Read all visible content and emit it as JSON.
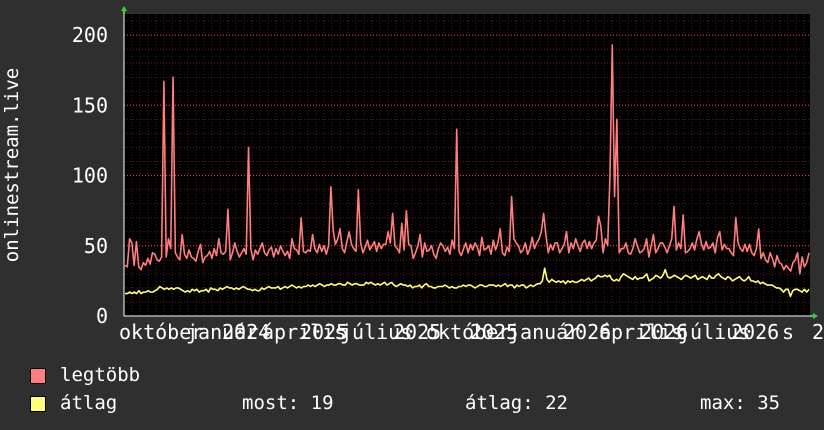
{
  "chart_data": {
    "type": "line",
    "ylabel": "onlinestream.live",
    "ylim": [
      0,
      215
    ],
    "yticks": [
      "0",
      "50",
      "100",
      "150",
      "200"
    ],
    "xticks": [
      "október",
      "január",
      "2024",
      "április",
      "2025",
      "július",
      "2025",
      "október",
      "2025",
      "január",
      "2026",
      "április",
      "2026",
      "július",
      "2026",
      "s",
      "2"
    ],
    "colors": {
      "max": "#ff7e7e",
      "avg": "#ffff7e",
      "grid": "#ff4040",
      "axis": "#ffffff"
    },
    "series": [
      {
        "name": "legtöbb",
        "values": [
          36,
          35,
          55,
          52,
          36,
          53,
          35,
          33,
          38,
          36,
          41,
          37,
          45,
          44,
          40,
          39,
          42,
          167,
          42,
          55,
          48,
          170,
          45,
          42,
          40,
          58,
          44,
          41,
          47,
          42,
          41,
          39,
          46,
          51,
          38,
          42,
          43,
          46,
          41,
          48,
          43,
          55,
          45,
          44,
          46,
          76,
          40,
          45,
          52,
          46,
          42,
          45,
          48,
          44,
          120,
          48,
          40,
          47,
          44,
          48,
          52,
          45,
          43,
          47,
          49,
          42,
          48,
          44,
          50,
          46,
          43,
          46,
          41,
          55,
          48,
          47,
          44,
          70,
          46,
          45,
          47,
          46,
          58,
          48,
          45,
          51,
          46,
          50,
          44,
          50,
          92,
          61,
          51,
          55,
          62,
          48,
          45,
          53,
          60,
          51,
          48,
          46,
          90,
          52,
          45,
          49,
          54,
          47,
          50,
          53,
          46,
          52,
          48,
          51,
          51,
          60,
          52,
          73,
          50,
          48,
          45,
          66,
          47,
          75,
          51,
          50,
          41,
          45,
          50,
          58,
          42,
          52,
          46,
          47,
          50,
          44,
          41,
          48,
          52,
          50,
          46,
          49,
          44,
          54,
          48,
          133,
          46,
          43,
          48,
          52,
          45,
          51,
          47,
          52,
          49,
          43,
          56,
          47,
          48,
          50,
          44,
          54,
          47,
          52,
          62,
          45,
          43,
          49,
          46,
          85,
          55,
          52,
          50,
          45,
          47,
          52,
          44,
          48,
          56,
          48,
          52,
          55,
          60,
          73,
          58,
          45,
          51,
          47,
          52,
          52,
          45,
          48,
          51,
          60,
          45,
          52,
          48,
          55,
          50,
          46,
          52,
          54,
          48,
          53,
          48,
          52,
          54,
          71,
          64,
          45,
          55,
          50,
          100,
          193,
          85,
          140,
          45,
          48,
          48,
          52,
          45,
          44,
          48,
          55,
          50,
          45,
          46,
          48,
          55,
          42,
          50,
          58,
          45,
          48,
          52,
          52,
          49,
          45,
          50,
          55,
          78,
          47,
          52,
          48,
          72,
          45,
          46,
          48,
          52,
          47,
          55,
          60,
          51,
          47,
          53,
          48,
          49,
          52,
          45,
          56,
          60,
          47,
          51,
          48,
          48,
          45,
          43,
          70,
          52,
          48,
          46,
          51,
          46,
          51,
          45,
          43,
          48,
          62,
          41,
          45,
          40,
          38,
          45,
          41,
          35,
          43,
          38,
          37,
          33,
          36,
          34,
          32,
          38,
          40,
          45,
          30,
          42,
          35,
          38,
          45
        ]
      },
      {
        "name": "átlag",
        "values": [
          16,
          16,
          17,
          16,
          17,
          16,
          18,
          16,
          17,
          17,
          18,
          17,
          17,
          18,
          19,
          21,
          20,
          19,
          20,
          19,
          20,
          19,
          20,
          20,
          19,
          18,
          17,
          18,
          17,
          19,
          18,
          19,
          17,
          18,
          18,
          19,
          17,
          20,
          19,
          19,
          18,
          20,
          19,
          20,
          21,
          20,
          20,
          19,
          20,
          19,
          20,
          21,
          20,
          19,
          19,
          18,
          19,
          18,
          18,
          20,
          19,
          20,
          21,
          20,
          20,
          20,
          21,
          19,
          20,
          21,
          20,
          21,
          22,
          21,
          20,
          21,
          20,
          21,
          21,
          22,
          21,
          22,
          21,
          22,
          23,
          22,
          21,
          22,
          22,
          23,
          22,
          22,
          23,
          23,
          22,
          22,
          24,
          23,
          22,
          23,
          23,
          22,
          22,
          22,
          24,
          23,
          24,
          23,
          22,
          23,
          22,
          23,
          24,
          22,
          23,
          24,
          22,
          21,
          22,
          23,
          22,
          22,
          21,
          22,
          20,
          21,
          21,
          22,
          20,
          22,
          23,
          21,
          21,
          20,
          20,
          21,
          21,
          21,
          22,
          21,
          20,
          21,
          20,
          20,
          21,
          21,
          22,
          21,
          22,
          22,
          21,
          20,
          21,
          22,
          22,
          21,
          21,
          22,
          22,
          22,
          21,
          22,
          21,
          22,
          23,
          21,
          22,
          22,
          20,
          22,
          21,
          22,
          22,
          20,
          21,
          22,
          21,
          22,
          23,
          23,
          25,
          34,
          26,
          24,
          26,
          25,
          24,
          25,
          24,
          25,
          23,
          25,
          24,
          25,
          24,
          24,
          25,
          26,
          25,
          26,
          27,
          25,
          26,
          27,
          29,
          28,
          28,
          29,
          28,
          29,
          26,
          25,
          26,
          25,
          28,
          30,
          29,
          28,
          27,
          26,
          28,
          26,
          27,
          27,
          28,
          30,
          25,
          26,
          27,
          29,
          28,
          27,
          29,
          33,
          28,
          27,
          28,
          29,
          28,
          27,
          26,
          28,
          29,
          28,
          27,
          28,
          29,
          26,
          27,
          28,
          27,
          26,
          29,
          27,
          27,
          29,
          30,
          28,
          27,
          26,
          28,
          27,
          25,
          26,
          27,
          28,
          26,
          25,
          26,
          28,
          25,
          25,
          24,
          25,
          23,
          24,
          23,
          22,
          22,
          22,
          21,
          20,
          20,
          19,
          17,
          19,
          19,
          14,
          18,
          19,
          19,
          18,
          17,
          19,
          17,
          19
        ]
      }
    ]
  },
  "legend": {
    "max_label": "legtöbb",
    "avg_label": "átlag",
    "now_text": "most: 19",
    "avg_text": "átlag: 22",
    "max_text": "max: 35"
  }
}
